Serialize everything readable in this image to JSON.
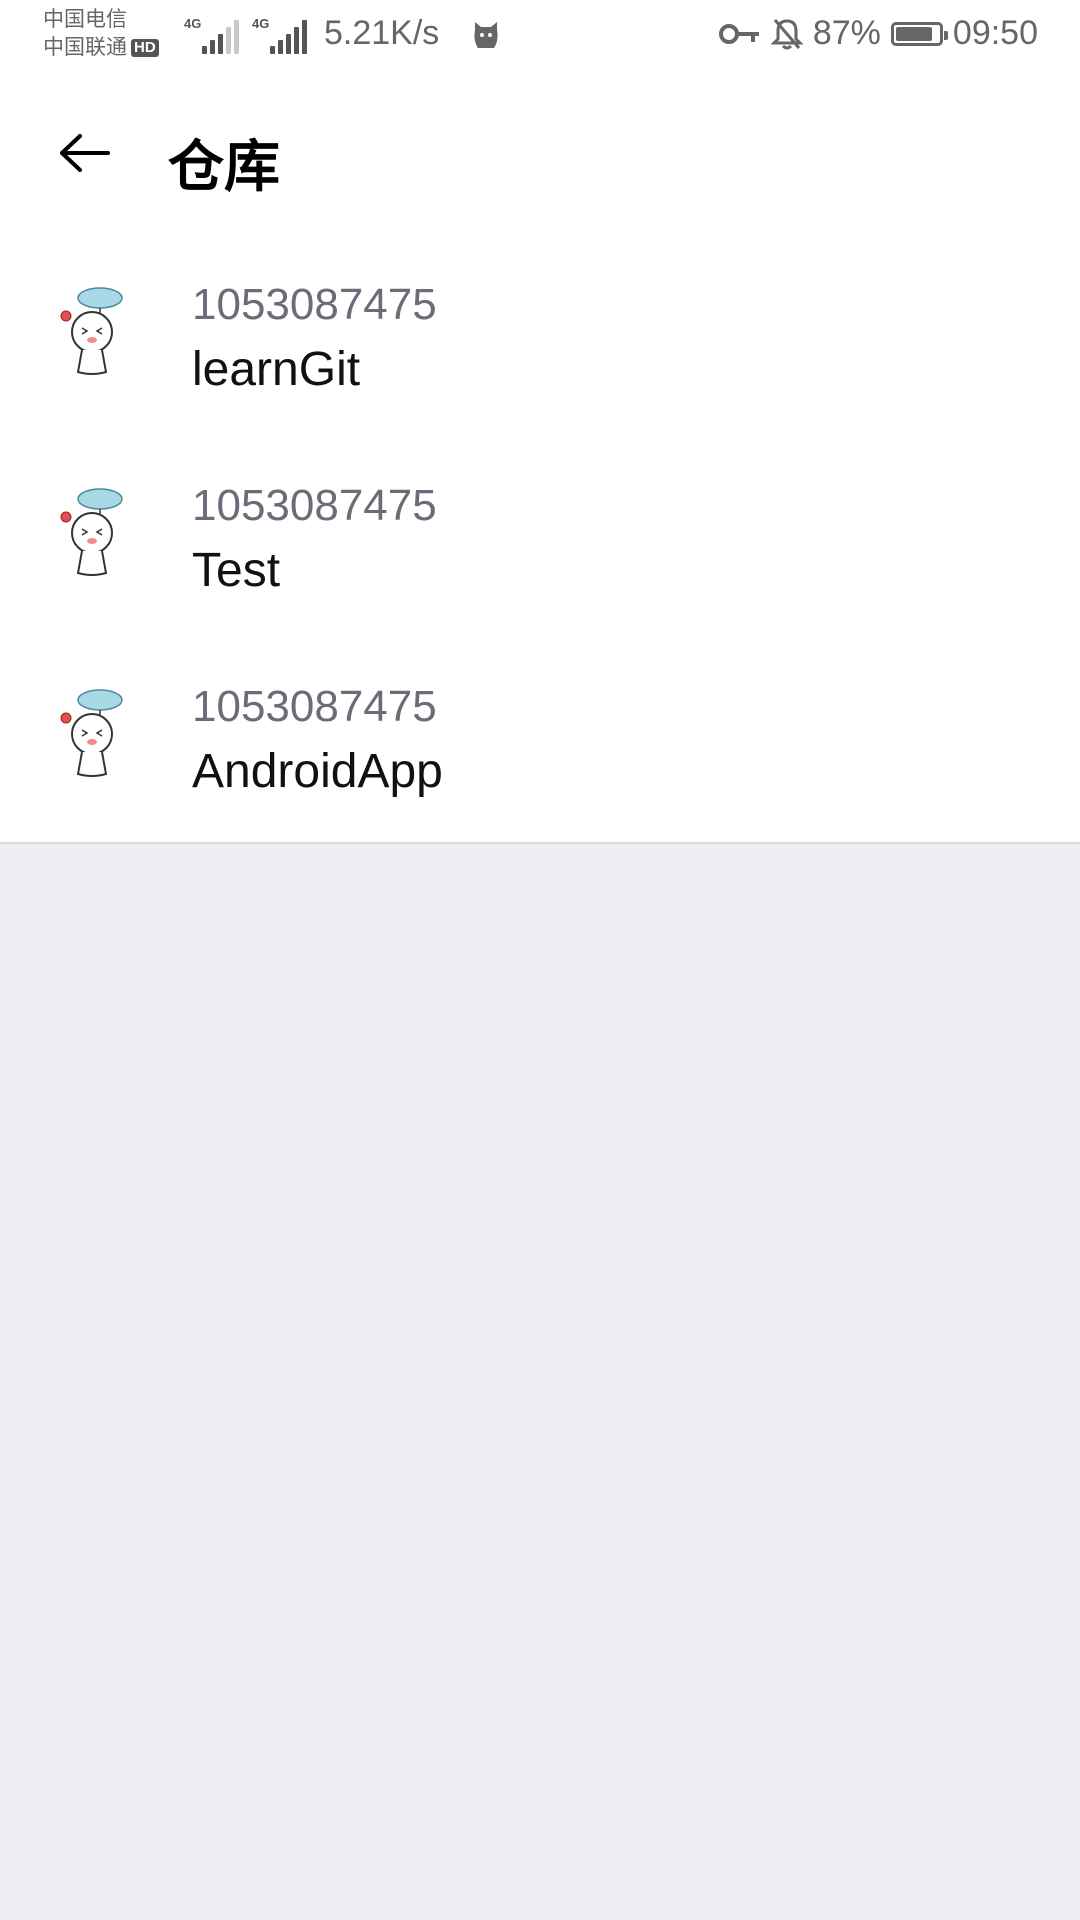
{
  "status_bar": {
    "carrier_1": "中国电信",
    "carrier_2": "中国联通",
    "hd_badge": "HD",
    "network_tag_1": "4G",
    "network_tag_2": "4G",
    "net_speed": "5.21K/s",
    "battery_percent": "87%",
    "battery_level": 0.87,
    "time": "09:50",
    "icons": [
      "signal-icon",
      "cat-app-icon",
      "key-icon",
      "bell-off-icon",
      "battery-icon"
    ]
  },
  "app_bar": {
    "title": "仓库",
    "back_icon": "arrow-left-icon"
  },
  "repos": [
    {
      "owner": "1053087475",
      "name": "learnGit"
    },
    {
      "owner": "1053087475",
      "name": "Test"
    },
    {
      "owner": "1053087475",
      "name": "AndroidApp"
    }
  ],
  "colors": {
    "page_background": "#eeeff4",
    "surface": "#ffffff",
    "owner_text": "#6c6c78",
    "name_text": "#111111"
  }
}
